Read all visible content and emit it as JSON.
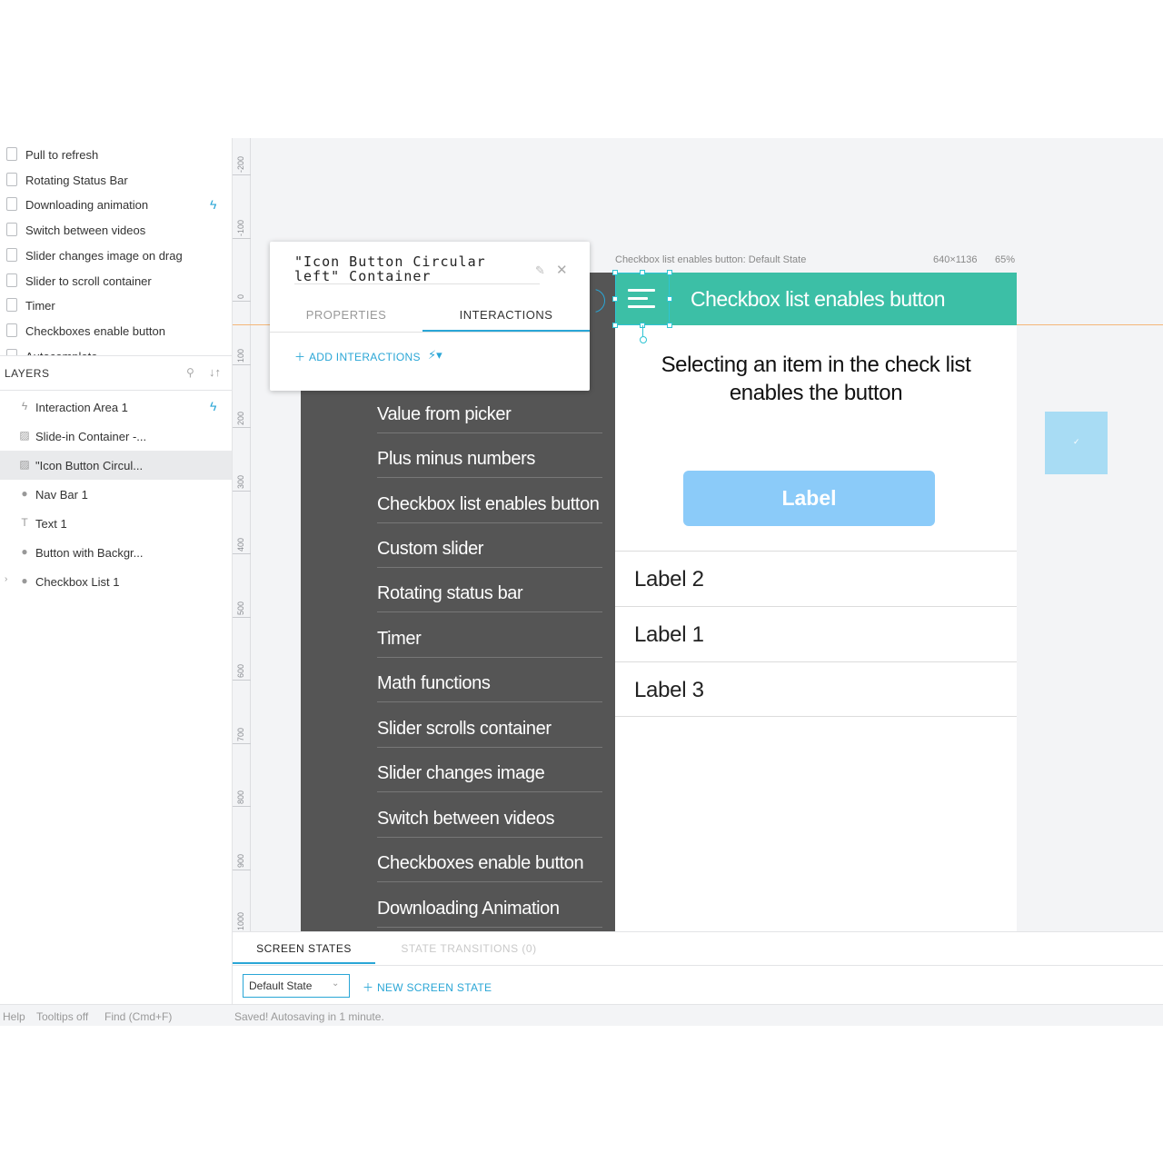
{
  "screens": [
    {
      "label": "Pull to refresh",
      "has_interaction": false
    },
    {
      "label": "Rotating Status Bar",
      "has_interaction": false
    },
    {
      "label": "Downloading animation",
      "has_interaction": true
    },
    {
      "label": "Switch between videos",
      "has_interaction": false
    },
    {
      "label": "Slider changes image on drag",
      "has_interaction": false
    },
    {
      "label": "Slider to scroll container",
      "has_interaction": false
    },
    {
      "label": "Timer",
      "has_interaction": false
    },
    {
      "label": "Checkboxes enable button",
      "has_interaction": false
    },
    {
      "label": "Autocomplete",
      "has_interaction": false
    }
  ],
  "layers": {
    "title": "LAYERS",
    "items": [
      {
        "label": "Interaction Area 1",
        "icon": "bolt-icon",
        "glyph": "ϟ",
        "has_interaction": true,
        "selected": false,
        "expandable": false
      },
      {
        "label": "Slide-in Container -...",
        "icon": "image-icon",
        "glyph": "▨",
        "has_interaction": false,
        "selected": false,
        "expandable": false
      },
      {
        "label": "\"Icon Button Circul...",
        "icon": "image-icon",
        "glyph": "▨",
        "has_interaction": false,
        "selected": true,
        "expandable": false
      },
      {
        "label": "Nav Bar 1",
        "icon": "apple-icon",
        "glyph": "●",
        "has_interaction": false,
        "selected": false,
        "expandable": false
      },
      {
        "label": "Text 1",
        "icon": "text-icon",
        "glyph": "T",
        "has_interaction": false,
        "selected": false,
        "expandable": false
      },
      {
        "label": "Button with Backgr...",
        "icon": "apple-icon",
        "glyph": "●",
        "has_interaction": false,
        "selected": false,
        "expandable": false
      },
      {
        "label": "Checkbox List 1",
        "icon": "apple-icon",
        "glyph": "●",
        "has_interaction": false,
        "selected": false,
        "expandable": true
      }
    ]
  },
  "ruler": {
    "ticks": [
      "-200",
      "-100",
      "0",
      "100",
      "200",
      "300",
      "400",
      "500",
      "600",
      "700",
      "800",
      "900",
      "1000"
    ]
  },
  "artboard": {
    "title": "Checkbox list enables button: Default State",
    "size": "640×1136",
    "zoom": "65%",
    "nav_title": "Checkbox list enables button",
    "description": "Selecting an item in the check list enables the button",
    "button_label": "Label",
    "checklist": [
      "Label 2",
      "Label 1",
      "Label 3"
    ]
  },
  "side_menu": [
    "Value from picker",
    "Plus minus numbers",
    "Checkbox list enables button",
    "Custom slider",
    "Rotating status bar",
    "Timer",
    "Math functions",
    "Slider scrolls container",
    "Slider changes image",
    "Switch between videos",
    "Checkboxes enable button",
    "Downloading Animation"
  ],
  "popup": {
    "title": "\"Icon Button Circular left\" Container",
    "tab_properties": "PROPERTIES",
    "tab_interactions": "INTERACTIONS",
    "add_interactions": "ADD INTERACTIONS"
  },
  "bottom_panel": {
    "tab_screen_states": "SCREEN STATES",
    "tab_transitions": "STATE TRANSITIONS (0)",
    "selected_state": "Default State",
    "new_state": "NEW SCREEN STATE"
  },
  "status_bar": {
    "help": "Help",
    "tooltips": "Tooltips  off",
    "find": "Find (Cmd+F)",
    "saved": "Saved! Autosaving in 1 minute."
  },
  "colors": {
    "accent": "#2aa6d6",
    "nav_bar": "#3cbfa6",
    "side_menu": "#555555",
    "button": "#8bcbf9"
  }
}
